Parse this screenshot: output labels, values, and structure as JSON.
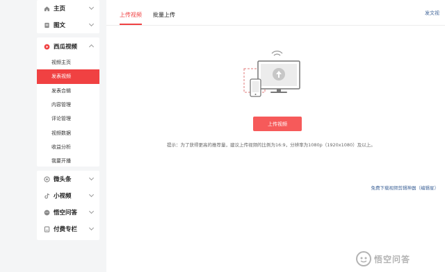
{
  "sidebar": {
    "group1": [
      {
        "label": "主页",
        "icon": "home-icon"
      },
      {
        "label": "图文",
        "icon": "article-icon"
      }
    ],
    "video_section": {
      "label": "西瓜视频",
      "icon": "xigua-icon",
      "items": [
        {
          "label": "视频主页"
        },
        {
          "label": "发表视频",
          "active": true
        },
        {
          "label": "发表合辑"
        },
        {
          "label": "内容管理"
        },
        {
          "label": "评论管理"
        },
        {
          "label": "视频数据"
        },
        {
          "label": "收益分析"
        },
        {
          "label": "我要开播"
        }
      ]
    },
    "group3": [
      {
        "label": "微头条",
        "icon": "micro-headline-icon"
      },
      {
        "label": "小视频",
        "icon": "short-video-icon"
      },
      {
        "label": "悟空问答",
        "icon": "wukong-qa-icon"
      },
      {
        "label": "付费专栏",
        "icon": "paid-column-icon"
      }
    ]
  },
  "main": {
    "tabs": [
      {
        "label": "上传视频",
        "active": true
      },
      {
        "label": "批量上传"
      }
    ],
    "publish_album_label": "发文视",
    "upload_button_label": "上传视频",
    "tip": "提示：为了获得更高的推荐量，建议上传视频的比例为16:9，分辨率为1080p（1920x1080）及以上。",
    "download_link": "免费下载视频剪辑神器（编辑星）"
  },
  "watermark": {
    "text": "悟空问答"
  },
  "colors": {
    "accent": "#f04142",
    "button": "#f65a5a",
    "link": "#406599"
  }
}
